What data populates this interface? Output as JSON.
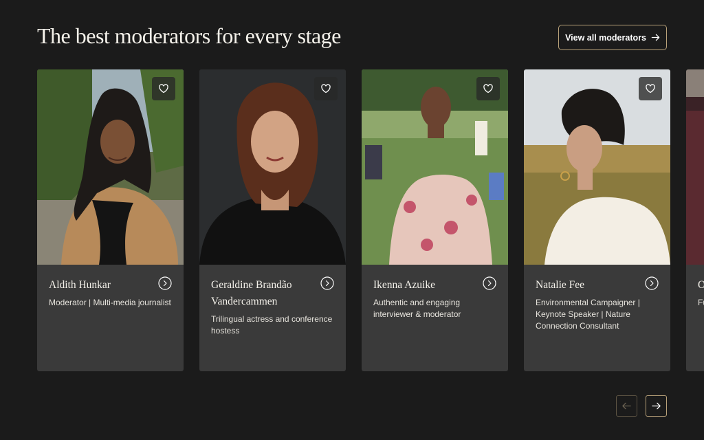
{
  "header": {
    "title": "The best moderators for every stage",
    "view_all_label": "View all moderators"
  },
  "cards": [
    {
      "name": "Aldith Hunkar",
      "role": "Moderator | Multi-media journalist",
      "photo": "portrait-photo-woman-dreadlocks-park"
    },
    {
      "name": "Geraldine Brandão Vandercammen",
      "role": "Trilingual actress and conference hostess",
      "photo": "portrait-photo-woman-auburn-hair-dark-background"
    },
    {
      "name": "Ikenna Azuike",
      "role": "Authentic and engaging interviewer & moderator",
      "photo": "portrait-photo-man-floral-shirt-picnic"
    },
    {
      "name": "Natalie Fee",
      "role": "Environmental Campaigner | Keynote Speaker | Nature Connection Consultant",
      "photo": "portrait-photo-woman-white-blouse-field"
    },
    {
      "name": "O",
      "role": "Fu",
      "photo": "portrait-photo-partial"
    }
  ],
  "icons": {
    "favorite": "heart-outline-icon",
    "open_profile": "arrow-right-circle-icon",
    "prev": "arrow-left-icon",
    "next": "arrow-right-icon"
  },
  "colors": {
    "background": "#1b1b1b",
    "card": "#3a3a3a",
    "accent_border": "#b9a27a"
  }
}
